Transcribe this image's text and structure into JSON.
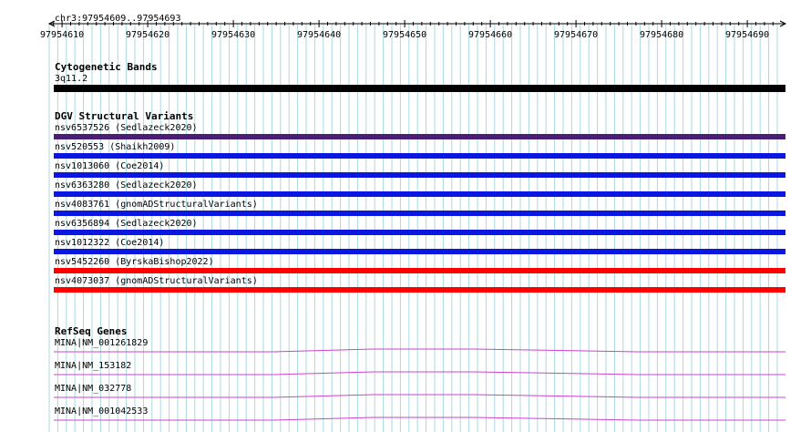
{
  "locus": "chr3:97954609..97954693",
  "ruler": {
    "start": 97954609,
    "end": 97954693,
    "ticks": [
      "97954610",
      "97954620",
      "97954630",
      "97954640",
      "97954650",
      "97954660",
      "97954670",
      "97954680",
      "97954690"
    ]
  },
  "colors": {
    "grid": "#a8d8e0",
    "cytoband": "#000000",
    "dgv_purple": "#4b1e75",
    "dgv_blue": "#0b16e0",
    "dgv_red": "#ff0000",
    "refseq": "#cc44cc"
  },
  "tracks": {
    "cytoband": {
      "title": "Cytogenetic Bands",
      "features": [
        {
          "label": "3q11.2"
        }
      ]
    },
    "dgv": {
      "title": "DGV Structural Variants",
      "features": [
        {
          "label": "nsv6537526 (Sedlazeck2020)",
          "color": "#4b1e75"
        },
        {
          "label": "nsv520553 (Shaikh2009)",
          "color": "#0b16e0"
        },
        {
          "label": "nsv1013060 (Coe2014)",
          "color": "#0b16e0"
        },
        {
          "label": "nsv6363280 (Sedlazeck2020)",
          "color": "#0b16e0"
        },
        {
          "label": "nsv4083761 (gnomADStructuralVariants)",
          "color": "#0b16e0"
        },
        {
          "label": "nsv6356894 (Sedlazeck2020)",
          "color": "#0b16e0"
        },
        {
          "label": "nsv1012322 (Coe2014)",
          "color": "#0b16e0"
        },
        {
          "label": "nsv5452260 (ByrskaBishop2022)",
          "color": "#ff0000"
        },
        {
          "label": "nsv4073037 (gnomADStructuralVariants)",
          "color": "#ff0000"
        }
      ]
    },
    "refseq": {
      "title": "RefSeq Genes",
      "features": [
        {
          "label": "MINA|NM_001261829"
        },
        {
          "label": "MINA|NM_153182"
        },
        {
          "label": "MINA|NM_032778"
        },
        {
          "label": "MINA|NM_001042533"
        }
      ]
    }
  }
}
